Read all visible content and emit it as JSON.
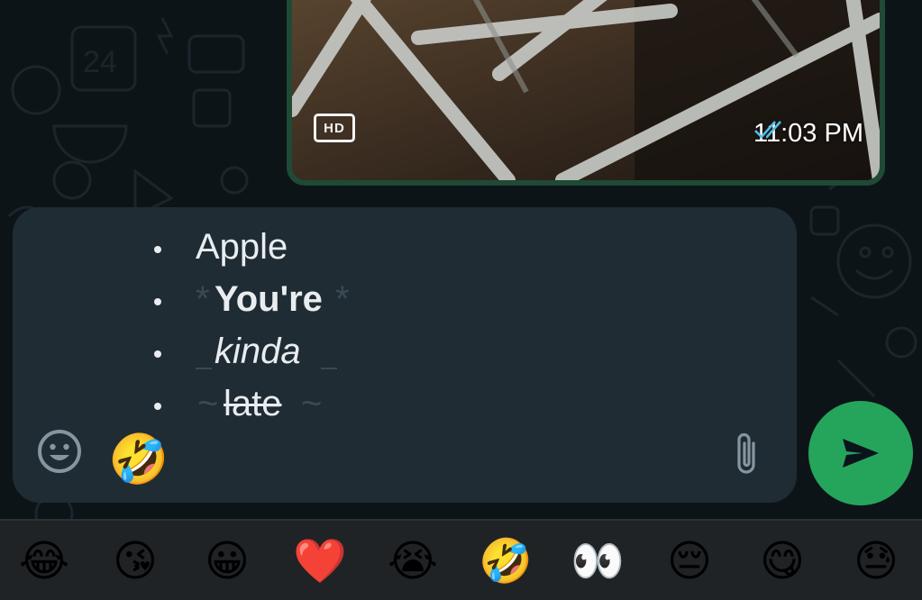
{
  "media_message": {
    "hd_label": "HD",
    "time": "11:03 PM",
    "status_icon": "double-check-icon",
    "status_color": "#53bdeb"
  },
  "compose": {
    "items": [
      {
        "text": "Apple",
        "style": "plain",
        "marker_left": "",
        "marker_right": ""
      },
      {
        "text": "You're",
        "style": "bold",
        "marker_left": "*",
        "marker_right": "*"
      },
      {
        "text": "kinda",
        "style": "italic",
        "marker_left": "_",
        "marker_right": "_"
      },
      {
        "text": "late",
        "style": "strike",
        "marker_left": "~",
        "marker_right": "~"
      }
    ],
    "typed_emoji": "🤣",
    "emoji_button_icon": "smiley-icon",
    "attach_icon": "paperclip-icon"
  },
  "send_button": {
    "icon": "send-icon",
    "color": "#25a55c"
  },
  "emoji_suggestions": [
    "😂",
    "😘",
    "😀",
    "❤️",
    "😭",
    "🤣",
    "👀",
    "😔",
    "😋",
    "😓"
  ],
  "colors": {
    "accent": "#25a55c",
    "compose_bg": "#1f2c34",
    "chat_bg": "#0d1418"
  }
}
